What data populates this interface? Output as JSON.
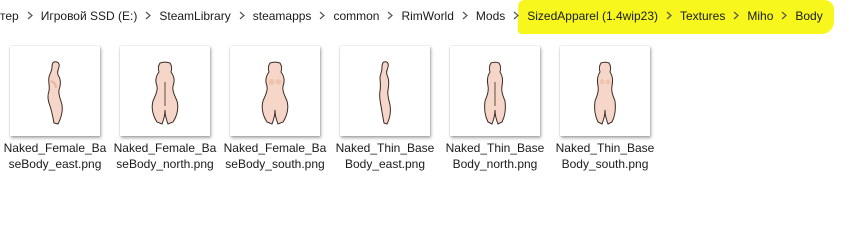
{
  "address_bar": {
    "breadcrumbs": [
      "тер",
      "Игровой SSD (E:)",
      "SteamLibrary",
      "steamapps",
      "common",
      "RimWorld",
      "Mods",
      "SizedApparel (1.4wip23)",
      "Textures",
      "Miho",
      "Body"
    ],
    "highlight_color": "#f7f71e"
  },
  "files": [
    {
      "name": "Naked_Female_BaseBody_east.png",
      "icon": "body-east-thumbnail"
    },
    {
      "name": "Naked_Female_BaseBody_north.png",
      "icon": "body-north-thumbnail"
    },
    {
      "name": "Naked_Female_BaseBody_south.png",
      "icon": "body-south-thumbnail"
    },
    {
      "name": "Naked_Thin_BaseBody_east.png",
      "icon": "body-east-thumbnail"
    },
    {
      "name": "Naked_Thin_BaseBody_north.png",
      "icon": "body-north-thumbnail"
    },
    {
      "name": "Naked_Thin_BaseBody_south.png",
      "icon": "body-south-thumbnail"
    }
  ],
  "colors": {
    "skin": "#f6d6c8",
    "skin_shade": "#e8b59e",
    "outline": "#3a2a24"
  }
}
